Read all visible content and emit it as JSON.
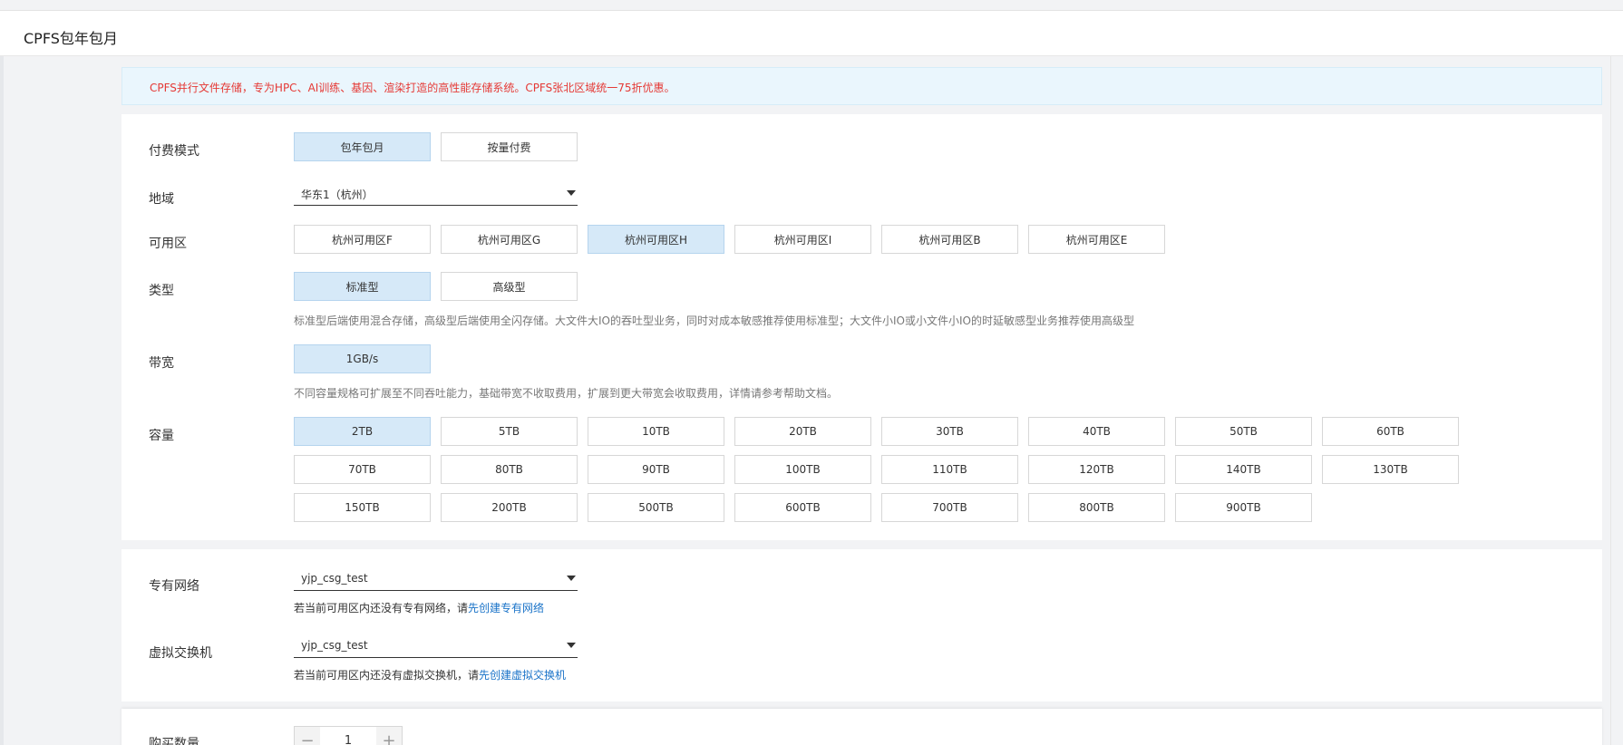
{
  "page": {
    "title": "CPFS包年包月"
  },
  "notice": {
    "text": "CPFS并行文件存储，专为HPC、AI训练、基因、渲染打造的高性能存储系统。CPFS张北区域统一75折优惠。"
  },
  "billing": {
    "label": "付费模式",
    "options": [
      "包年包月",
      "按量付费"
    ],
    "selected": "包年包月"
  },
  "region": {
    "label": "地域",
    "value": "华东1（杭州）"
  },
  "zone": {
    "label": "可用区",
    "options": [
      "杭州可用区F",
      "杭州可用区G",
      "杭州可用区H",
      "杭州可用区I",
      "杭州可用区B",
      "杭州可用区E"
    ],
    "selected": "杭州可用区H"
  },
  "type": {
    "label": "类型",
    "options": [
      "标准型",
      "高级型"
    ],
    "selected": "标准型",
    "hint": "标准型后端使用混合存储，高级型后端使用全闪存储。大文件大IO的吞吐型业务，同时对成本敏感推荐使用标准型；大文件小IO或小文件小IO的时延敏感型业务推荐使用高级型"
  },
  "bandwidth": {
    "label": "带宽",
    "options": [
      "1GB/s"
    ],
    "selected": "1GB/s",
    "hint": "不同容量规格可扩展至不同吞吐能力，基础带宽不收取费用，扩展到更大带宽会收取费用，详情请参考帮助文档。"
  },
  "capacity": {
    "label": "容量",
    "options": [
      "2TB",
      "5TB",
      "10TB",
      "20TB",
      "30TB",
      "40TB",
      "50TB",
      "60TB",
      "70TB",
      "80TB",
      "90TB",
      "100TB",
      "110TB",
      "120TB",
      "140TB",
      "130TB",
      "150TB",
      "200TB",
      "500TB",
      "600TB",
      "700TB",
      "800TB",
      "900TB"
    ],
    "selected": "2TB"
  },
  "vpc": {
    "label": "专有网络",
    "value": "yjp_csg_test",
    "hint_prefix": "若当前可用区内还没有专有网络，请",
    "hint_link": "先创建专有网络"
  },
  "vswitch": {
    "label": "虚拟交换机",
    "value": "yjp_csg_test",
    "hint_prefix": "若当前可用区内还没有虚拟交换机，请",
    "hint_link": "先创建虚拟交换机"
  },
  "quantity": {
    "label": "购买数量",
    "value": "1",
    "minus": "−",
    "plus": "+"
  }
}
